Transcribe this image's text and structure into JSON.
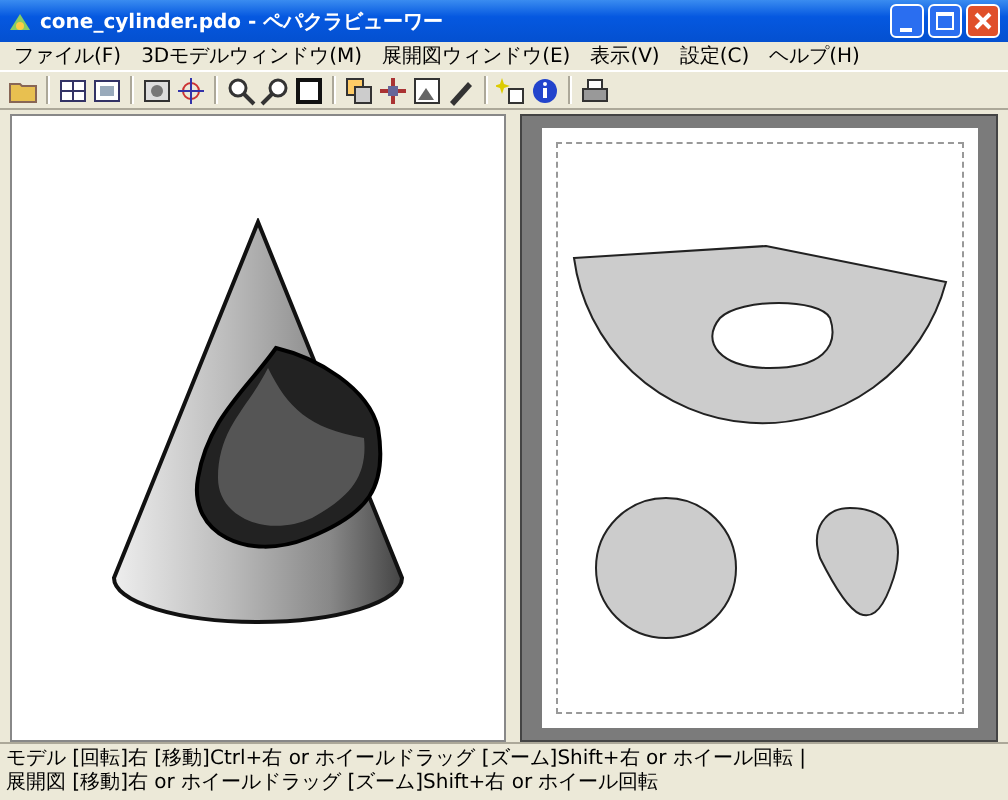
{
  "window": {
    "title": "cone_cylinder.pdo - ペパクラビューワー"
  },
  "menu": [
    "ファイル(F)",
    "3Dモデルウィンドウ(M)",
    "展開図ウィンドウ(E)",
    "表示(V)",
    "設定(C)",
    "ヘルプ(H)"
  ],
  "status_bar": [
    "モデル [回転]右 [移動]Ctrl+右 or ホイールドラッグ [ズーム]Shift+右 or ホイール回転 |",
    "展開図 [移動]右 or ホイールドラッグ [ズーム]Shift+右 or ホイール回転"
  ]
}
